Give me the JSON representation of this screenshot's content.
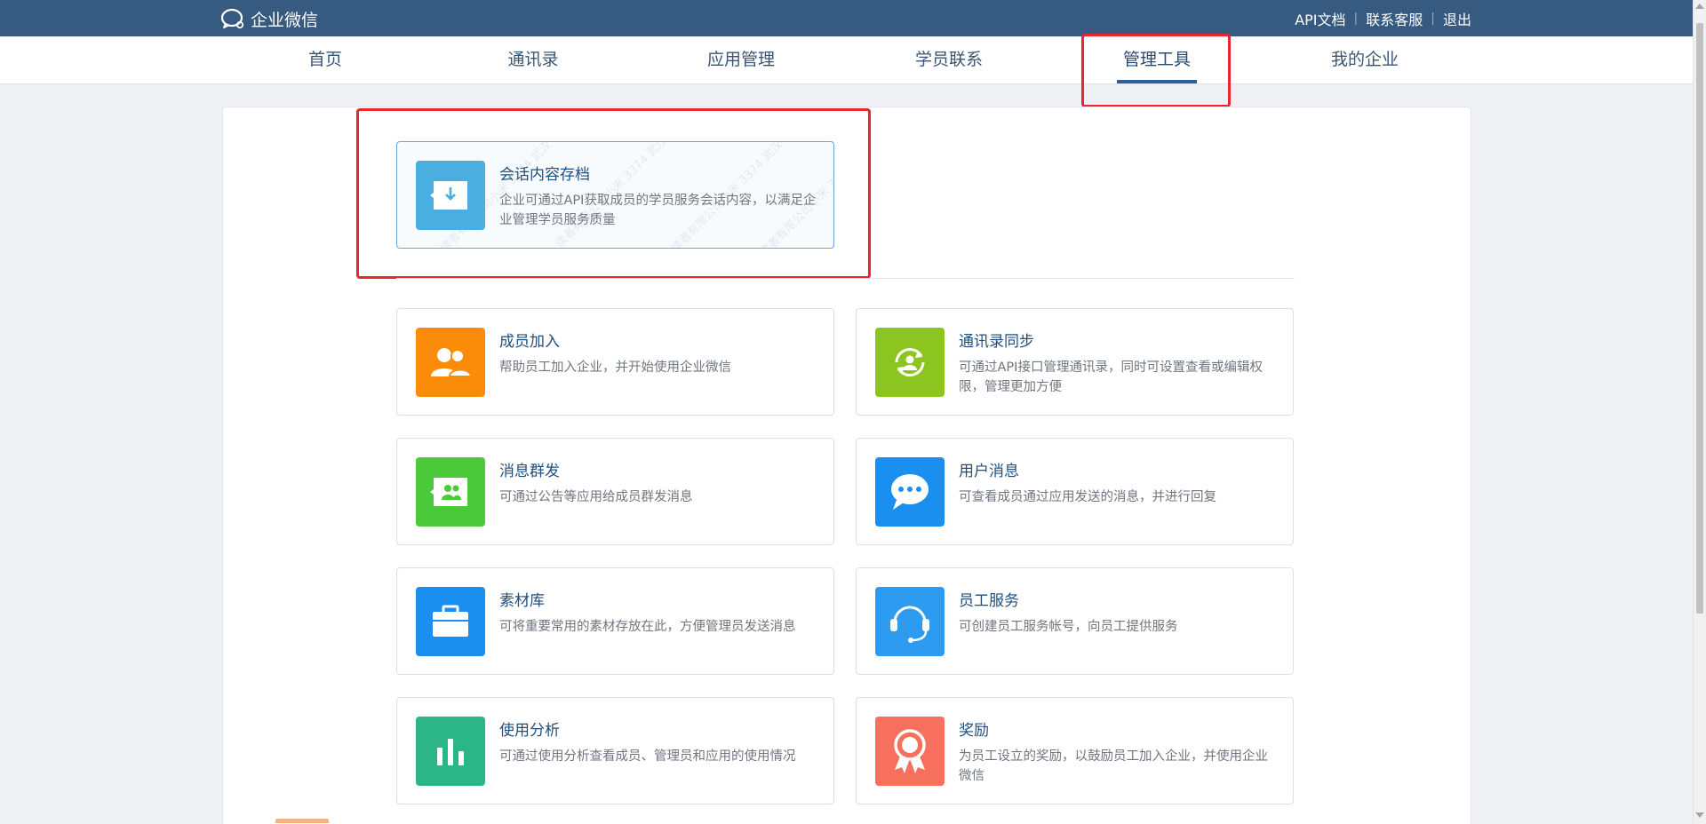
{
  "brand": {
    "name": "企业微信",
    "icon": "wechat-work-logo"
  },
  "top_links": {
    "api_docs": "API文档",
    "contact_service": "联系客服",
    "logout": "退出",
    "separator": "|"
  },
  "nav": {
    "items": [
      {
        "label": "首页"
      },
      {
        "label": "通讯录"
      },
      {
        "label": "应用管理"
      },
      {
        "label": "学员联系"
      },
      {
        "label": "管理工具"
      },
      {
        "label": "我的企业"
      }
    ],
    "active_index": 4
  },
  "featured": {
    "title": "会话内容存档",
    "desc": "企业可通过API获取成员的学员服务会话内容，以满足企业管理学员服务质量",
    "icon": "chat-archive-icon",
    "color": "#4aaee0",
    "watermark": "读者有限公司小米 3374 武汉 智慧"
  },
  "tools": [
    {
      "title": "成员加入",
      "desc": "帮助员工加入企业，并开始使用企业微信",
      "icon": "members-icon",
      "color": "#fa8c0a"
    },
    {
      "title": "通讯录同步",
      "desc": "可通过API接口管理通讯录，同时可设置查看或编辑权限，管理更加方便",
      "icon": "sync-icon",
      "color": "#8dc520"
    },
    {
      "title": "消息群发",
      "desc": "可通过公告等应用给成员群发消息",
      "icon": "broadcast-icon",
      "color": "#4cc93a"
    },
    {
      "title": "用户消息",
      "desc": "可查看成员通过应用发送的消息，并进行回复",
      "icon": "chat-bubble-icon",
      "color": "#1a8ff0"
    },
    {
      "title": "素材库",
      "desc": "可将重要常用的素材存放在此，方便管理员发送消息",
      "icon": "briefcase-icon",
      "color": "#1a8ff0"
    },
    {
      "title": "员工服务",
      "desc": "可创建员工服务帐号，向员工提供服务",
      "icon": "headset-icon",
      "color": "#2d9bf0"
    },
    {
      "title": "使用分析",
      "desc": "可通过使用分析查看成员、管理员和应用的使用情况",
      "icon": "bar-chart-icon",
      "color": "#2cb586"
    },
    {
      "title": "奖励",
      "desc": "为员工设立的奖励，以鼓励员工加入企业，并使用企业微信",
      "icon": "award-icon",
      "color": "#f6705d"
    }
  ]
}
